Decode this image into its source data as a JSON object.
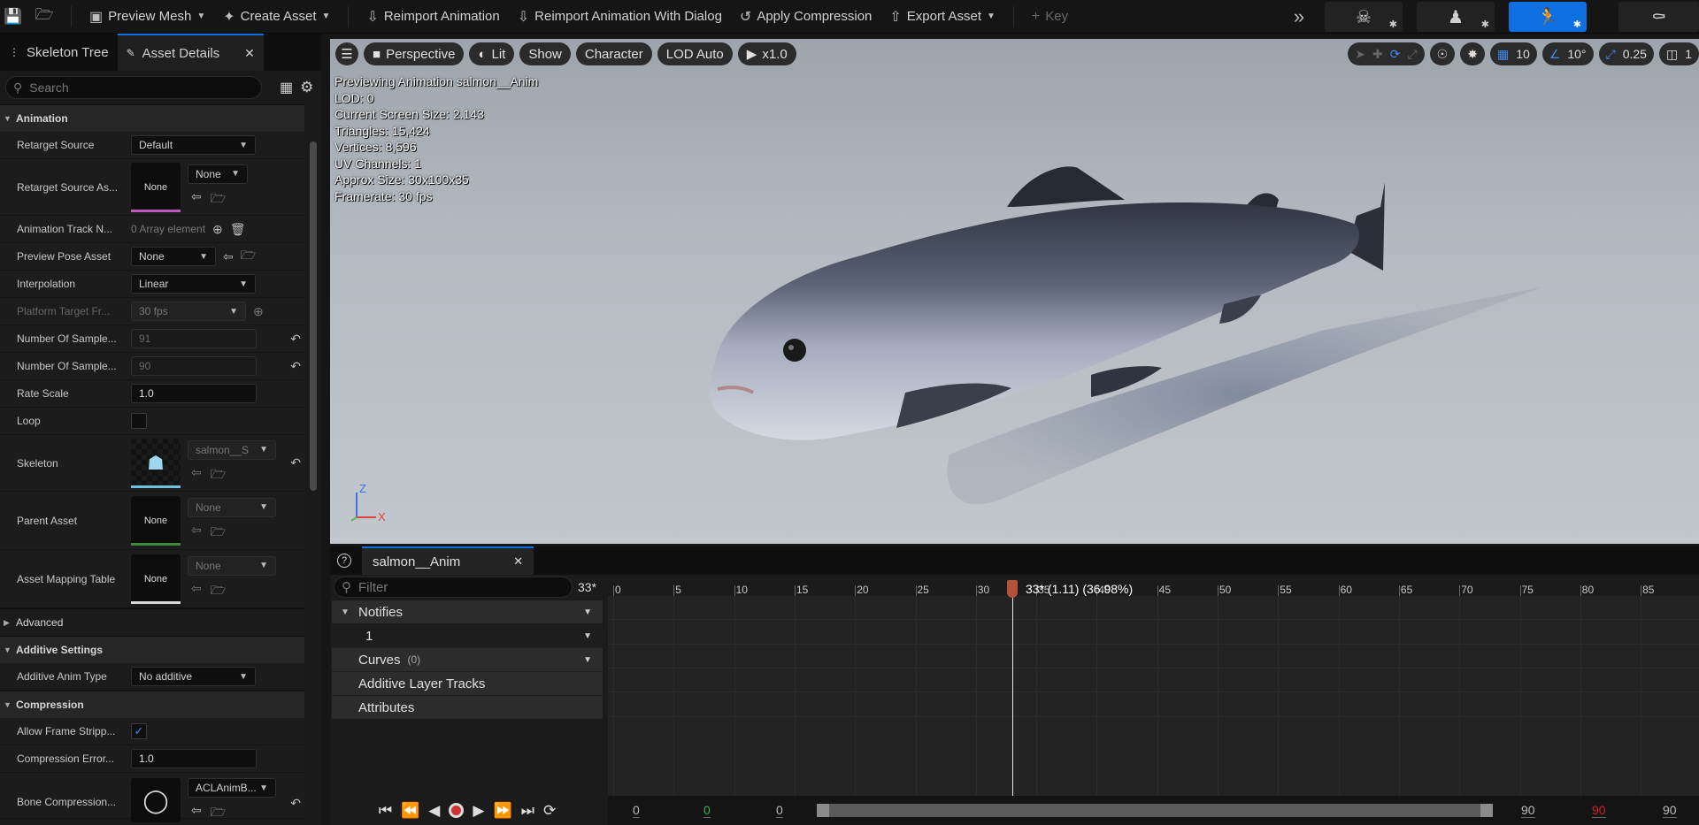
{
  "toolbar": {
    "preview_mesh": "Preview Mesh",
    "create_asset": "Create Asset",
    "reimport": "Reimport Animation",
    "reimport_dialog": "Reimport Animation With Dialog",
    "apply_compression": "Apply Compression",
    "export_asset": "Export Asset",
    "key": "Key"
  },
  "left_panel": {
    "tab_skeleton": "Skeleton Tree",
    "tab_details": "Asset Details",
    "search_placeholder": "Search",
    "cat_animation": "Animation",
    "retarget_source": {
      "label": "Retarget Source",
      "value": "Default"
    },
    "retarget_source_asset": {
      "label": "Retarget Source As...",
      "thumb": "None",
      "value": "None"
    },
    "anim_track": {
      "label": "Animation Track N...",
      "value": "0 Array element"
    },
    "preview_pose": {
      "label": "Preview Pose Asset",
      "value": "None"
    },
    "interpolation": {
      "label": "Interpolation",
      "value": "Linear"
    },
    "platform_target": {
      "label": "Platform Target Fr...",
      "value": "30 fps"
    },
    "num_samples_1": {
      "label": "Number Of Sample...",
      "value": "91"
    },
    "num_samples_2": {
      "label": "Number Of Sample...",
      "value": "90"
    },
    "rate_scale": {
      "label": "Rate Scale",
      "value": "1.0"
    },
    "loop": {
      "label": "Loop"
    },
    "skeleton": {
      "label": "Skeleton",
      "value": "salmon__S"
    },
    "parent_asset": {
      "label": "Parent Asset",
      "thumb": "None",
      "value": "None"
    },
    "mapping_table": {
      "label": "Asset Mapping Table",
      "thumb": "None",
      "value": "None"
    },
    "cat_advanced": "Advanced",
    "cat_additive": "Additive Settings",
    "additive_type": {
      "label": "Additive Anim Type",
      "value": "No additive"
    },
    "cat_compression": "Compression",
    "allow_frame": {
      "label": "Allow Frame Stripp..."
    },
    "compression_error": {
      "label": "Compression Error...",
      "value": "1.0"
    },
    "bone_compression": {
      "label": "Bone Compression...",
      "value": "ACLAnimB..."
    }
  },
  "viewport": {
    "perspective": "Perspective",
    "lit": "Lit",
    "show": "Show",
    "character": "Character",
    "lod": "LOD Auto",
    "speed": "x1.0",
    "grid_value": "10",
    "angle_value": "10°",
    "scale_value": "0.25",
    "camera_value": "1",
    "stats": [
      "Previewing Animation salmon__Anim",
      "LOD: 0",
      "Current Screen Size: 2.143",
      "Triangles: 15,424",
      "Vertices: 8,596",
      "UV Channels: 1",
      "Approx Size: 30x100x35",
      "Framerate: 30 fps"
    ],
    "axis_z": "Z",
    "axis_x": "X"
  },
  "sequencer": {
    "tab": "salmon__Anim",
    "filter_placeholder": "Filter",
    "current_frame": "33*",
    "playhead_label": "33* (1.11) (36.98%)",
    "tracks": {
      "notifies": "Notifies",
      "notify_1": "1",
      "curves": "Curves",
      "curves_count": "(0)",
      "additive": "Additive Layer Tracks",
      "attributes": "Attributes"
    },
    "ruler": [
      "0",
      "5",
      "10",
      "15",
      "20",
      "25",
      "30",
      "35",
      "40",
      "45",
      "50",
      "55",
      "60",
      "65",
      "70",
      "75",
      "80",
      "85"
    ],
    "range": {
      "start": "0",
      "green": "0",
      "view_start": "0",
      "view_end": "90",
      "red": "90",
      "end": "90"
    }
  }
}
